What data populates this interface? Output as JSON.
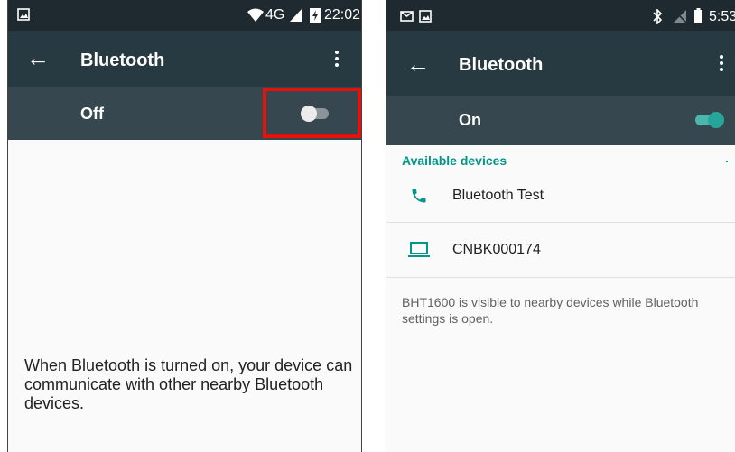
{
  "left_screen": {
    "status_bar": {
      "icons": [
        "image-icon",
        "wifi-icon",
        "signal-icon",
        "battery-charging-icon"
      ],
      "network": "4G",
      "time": "22:02"
    },
    "app_bar": {
      "title": "Bluetooth",
      "back_icon": "arrow-back-icon",
      "menu_icon": "more-vert-icon"
    },
    "switch": {
      "label": "Off",
      "state": "off",
      "highlighted": true
    },
    "empty_message": "When Bluetooth is turned on, your device can communicate with other nearby Bluetooth devices."
  },
  "right_screen": {
    "status_bar": {
      "icons": [
        "email-icon",
        "image-icon",
        "bluetooth-icon",
        "signal-icon",
        "battery-icon"
      ],
      "time": "5:53"
    },
    "app_bar": {
      "title": "Bluetooth",
      "back_icon": "arrow-back-icon",
      "menu_icon": "more-vert-icon"
    },
    "switch": {
      "label": "On",
      "state": "on"
    },
    "section_header": "Available devices",
    "devices": [
      {
        "name": "Bluetooth Test",
        "icon": "phone-icon"
      },
      {
        "name": "CNBK000174",
        "icon": "laptop-icon"
      }
    ],
    "footer": "BHT1600 is visible to nearby devices while Bluetooth settings is open."
  },
  "colors": {
    "status_bar": "#1e2a30",
    "app_bar": "#283a41",
    "switch_bar": "#37474f",
    "accent": "#009688",
    "highlight": "#e3120b"
  }
}
